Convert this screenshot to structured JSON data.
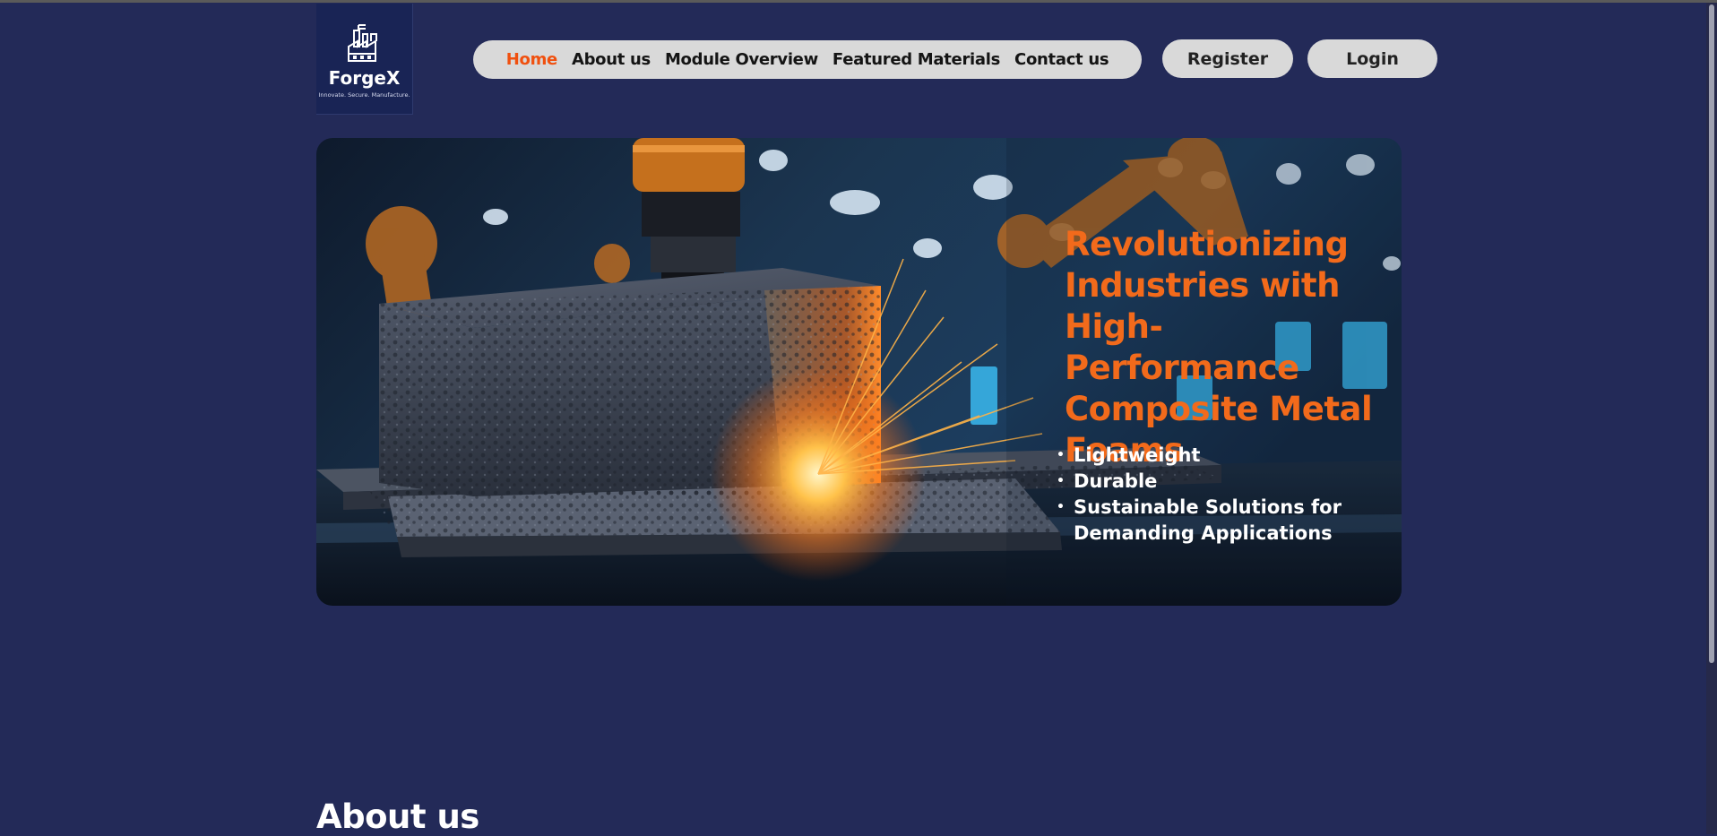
{
  "brand": {
    "name": "ForgeX",
    "tagline": "Innovate. Secure. Manufacture."
  },
  "nav": {
    "items": [
      {
        "label": "Home",
        "active": true
      },
      {
        "label": "About us"
      },
      {
        "label": "Module Overview"
      },
      {
        "label": "Featured Materials"
      },
      {
        "label": "Contact us"
      }
    ]
  },
  "auth": {
    "register_label": "Register",
    "login_label": "Login"
  },
  "hero": {
    "title": "Revolutionizing Industries with High-Performance Composite Metal Foams",
    "bullets": [
      "Lightweight",
      "Durable",
      "Sustainable Solutions for Demanding Applications"
    ]
  },
  "about": {
    "heading": "About us"
  },
  "colors": {
    "page_background": "#232a58",
    "accent": "#f0500f",
    "nav_background": "#d9d9d9"
  }
}
